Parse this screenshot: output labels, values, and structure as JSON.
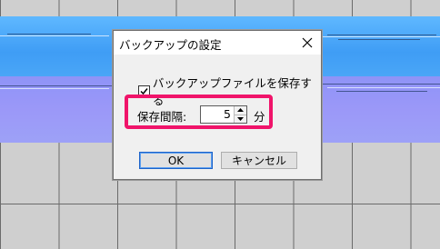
{
  "dialog": {
    "title": "バックアップの設定",
    "close_icon": "close-icon",
    "checkbox_label": "バックアップファイルを保存する",
    "checkbox_checked": true,
    "interval_label": "保存間隔:",
    "interval_value": "5",
    "interval_unit": "分",
    "ok_label": "OK",
    "cancel_label": "キャンセル"
  },
  "colors": {
    "highlight": "#f0146a",
    "band_top": "#4aa6f7",
    "band_bottom": "#9b98f8"
  }
}
